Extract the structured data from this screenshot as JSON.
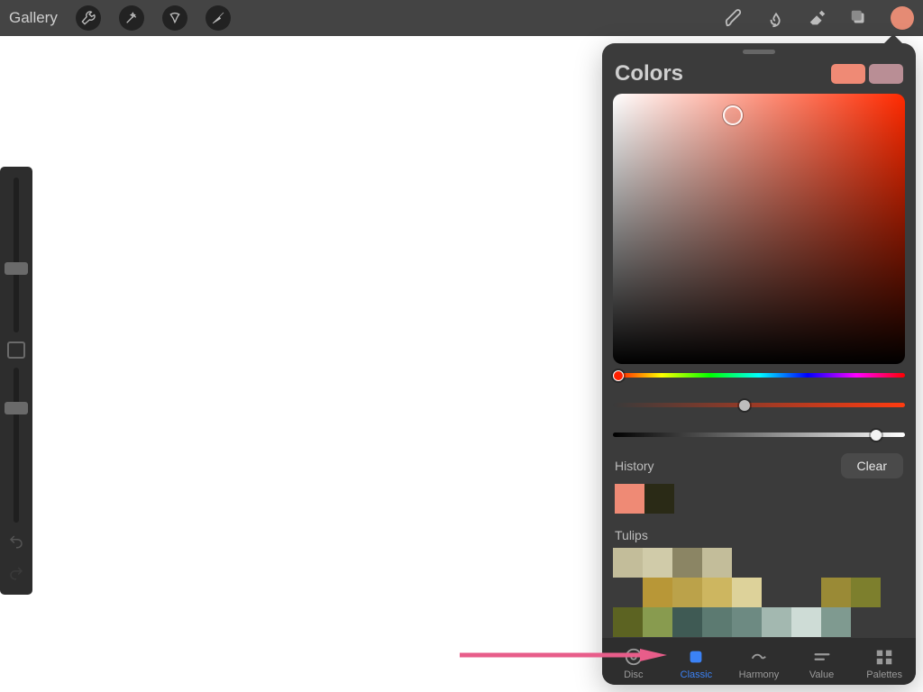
{
  "topbar": {
    "gallery_label": "Gallery"
  },
  "sidebar": {
    "brush_size_handle_pct": 55,
    "opacity_handle_pct": 22
  },
  "color_panel": {
    "title": "Colors",
    "primary_swatch": "#ef8a75",
    "secondary_swatch": "#b98e95",
    "hue_deg": 10,
    "saturation_pct": 45,
    "value_pct": 90,
    "history_label": "History",
    "clear_label": "Clear",
    "history_colors": [
      "#ef8a75",
      "#2a2a16"
    ],
    "palette_name": "Tulips",
    "palette_colors": [
      "#c3bd9a",
      "#d0cba9",
      "#8b8564",
      "#c3bd9a",
      "#b89737",
      "#bba24a",
      "#cdb660",
      "#ddd29a",
      "#9a8a36",
      "#7d7f2d",
      "#5c6322",
      "#7d7f2d",
      "#889b4f",
      "#3f5a54",
      "#5c7a71",
      "#6d8a82",
      "#a3b8b0",
      "#cedcd6",
      "#7f9a90"
    ],
    "tabs": {
      "disc": "Disc",
      "classic": "Classic",
      "harmony": "Harmony",
      "value": "Value",
      "palettes": "Palettes",
      "active": "classic"
    }
  }
}
